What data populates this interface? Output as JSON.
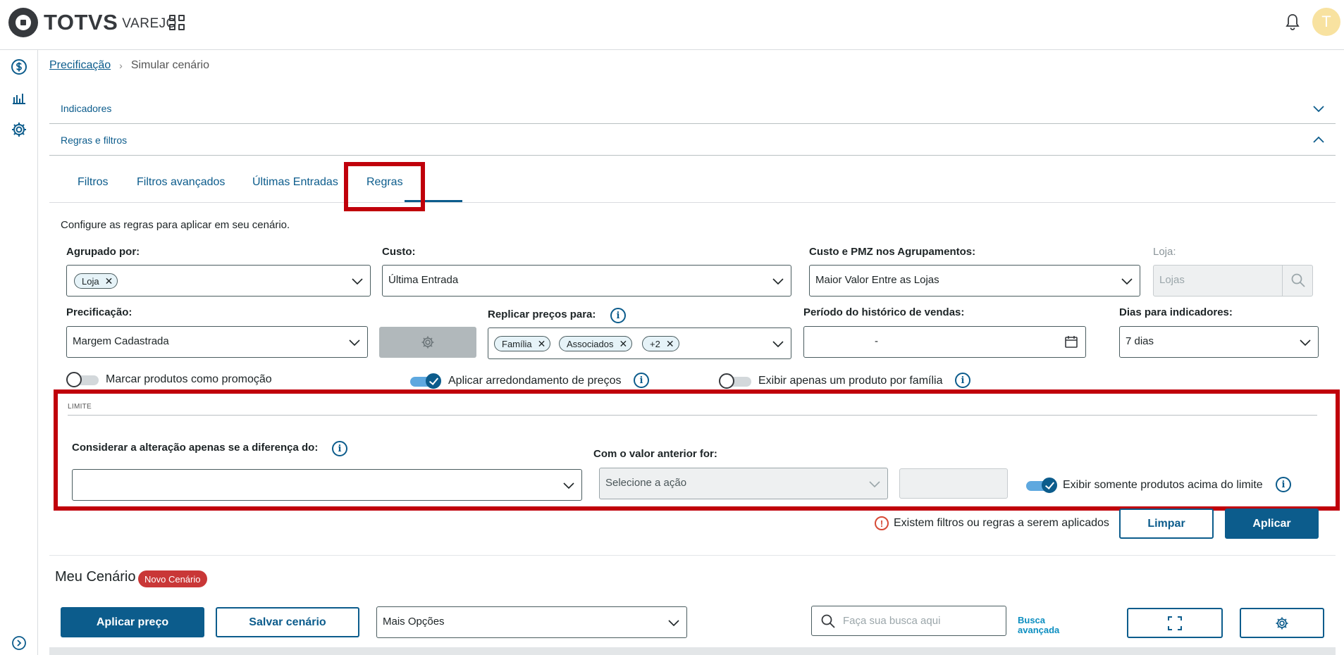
{
  "app": {
    "brand": "TOTVS",
    "brand_sub": "VAREJO",
    "avatar_initial": "T"
  },
  "breadcrumb": {
    "link": "Precificação",
    "current": "Simular cenário"
  },
  "accordions": {
    "indicadores": "Indicadores",
    "regras": "Regras e filtros"
  },
  "tabs": [
    "Filtros",
    "Filtros avançados",
    "Últimas Entradas",
    "Regras"
  ],
  "rules": {
    "description": "Configure as regras para aplicar em seu cenário.",
    "agrupado": {
      "label": "Agrupado por:",
      "chip": "Loja"
    },
    "custo": {
      "label": "Custo:",
      "value": "Última Entrada"
    },
    "custo_pmz": {
      "label": "Custo e PMZ nos Agrupamentos:",
      "value": "Maior Valor Entre as Lojas"
    },
    "loja": {
      "label": "Loja:",
      "placeholder": "Lojas"
    },
    "precificacao": {
      "label": "Precificação:",
      "value": "Margem Cadastrada"
    },
    "replicar": {
      "label": "Replicar preços para:",
      "chips": [
        "Família",
        "Associados",
        "+2"
      ]
    },
    "periodo": {
      "label": "Período do histórico de vendas:",
      "value": "-"
    },
    "dias": {
      "label": "Dias para indicadores:",
      "value": "7 dias"
    },
    "toggles": {
      "promocao": "Marcar produtos como promoção",
      "arredondamento": "Aplicar arredondamento de preços",
      "familia": "Exibir apenas um produto por família"
    }
  },
  "limite": {
    "section": "LIMITE",
    "diferenca_label": "Considerar a alteração apenas se a diferença do:",
    "anterior_label": "Com o valor anterior for:",
    "acao_placeholder": "Selecione a ação",
    "acima_label": "Exibir somente produtos acima do limite"
  },
  "footer": {
    "warning": "Existem filtros ou regras a serem aplicados",
    "clear": "Limpar",
    "apply": "Aplicar"
  },
  "cenario": {
    "title": "Meu Cenário",
    "badge": "Novo Cenário",
    "apply_price": "Aplicar preço",
    "save": "Salvar cenário",
    "more_options": "Mais Opções",
    "search_placeholder": "Faça sua busca aqui",
    "advanced_search_1": "Busca",
    "advanced_search_2": "avançada"
  },
  "colors": {
    "primary": "#0c5c8c",
    "highlight": "#c0000b",
    "badge": "#c93737"
  }
}
